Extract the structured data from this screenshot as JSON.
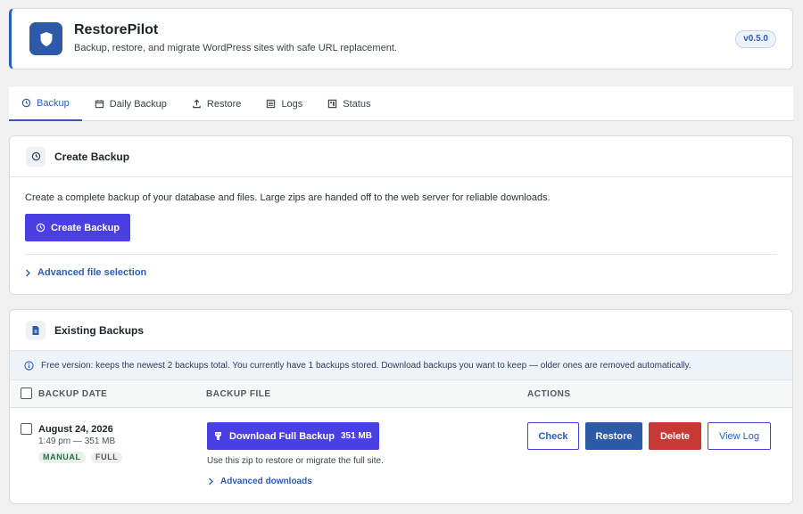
{
  "header": {
    "title": "RestorePilot",
    "subtitle": "Backup, restore, and migrate WordPress sites with safe URL replacement.",
    "version": "v0.5.0"
  },
  "tabs": [
    {
      "label": "Backup",
      "icon": "clock-history-icon",
      "active": true
    },
    {
      "label": "Daily Backup",
      "icon": "calendar-icon",
      "active": false
    },
    {
      "label": "Restore",
      "icon": "upload-icon",
      "active": false
    },
    {
      "label": "Logs",
      "icon": "list-icon",
      "active": false
    },
    {
      "label": "Status",
      "icon": "status-icon",
      "active": false
    }
  ],
  "create_backup": {
    "title": "Create Backup",
    "description": "Create a complete backup of your database and files. Large zips are handed off to the web server for reliable downloads.",
    "button_label": "Create Backup",
    "advanced_label": "Advanced file selection"
  },
  "existing_backups": {
    "title": "Existing Backups",
    "notice": "Free version: keeps the newest 2 backups total. You currently have 1 backups stored. Download backups you want to keep — older ones are removed automatically.",
    "columns": [
      "BACKUP DATE",
      "BACKUP FILE",
      "ACTIONS"
    ],
    "rows": [
      {
        "date": "August 24, 2026",
        "time_size": "1:49 pm — 351 MB",
        "tags": [
          "MANUAL",
          "FULL"
        ],
        "download_label": "Download Full Backup",
        "download_size": "351 MB",
        "hint": "Use this zip to restore or migrate the full site.",
        "advanced_downloads": "Advanced downloads",
        "actions": {
          "check": "Check",
          "restore": "Restore",
          "delete": "Delete",
          "view_log": "View Log"
        }
      }
    ]
  },
  "colors": {
    "accent": "#2c5db6",
    "primary_button": "#4a3fe0",
    "restore": "#2d5aa8",
    "delete": "#c63a35"
  }
}
